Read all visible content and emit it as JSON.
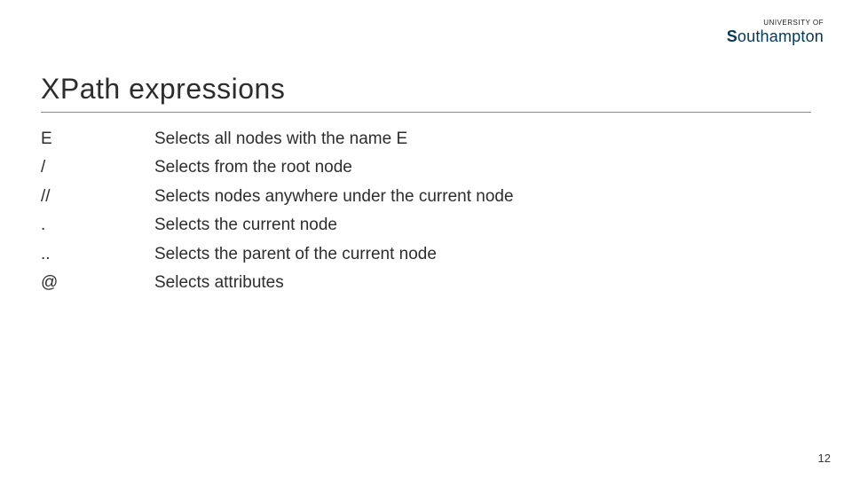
{
  "logo": {
    "top_line": "UNIVERSITY OF",
    "name_prefix": "S",
    "name_rest": "outhampton"
  },
  "title": "XPath expressions",
  "rows": [
    {
      "symbol": "E",
      "description": "Selects all nodes with the name E"
    },
    {
      "symbol": "/",
      "description": "Selects from the root node"
    },
    {
      "symbol": "//",
      "description": "Selects nodes anywhere under the current node"
    },
    {
      "symbol": ".",
      "description": "Selects the current node"
    },
    {
      "symbol": "..",
      "description": "Selects the parent of the current node"
    },
    {
      "symbol": "@",
      "description": "Selects attributes"
    }
  ],
  "page_number": "12"
}
